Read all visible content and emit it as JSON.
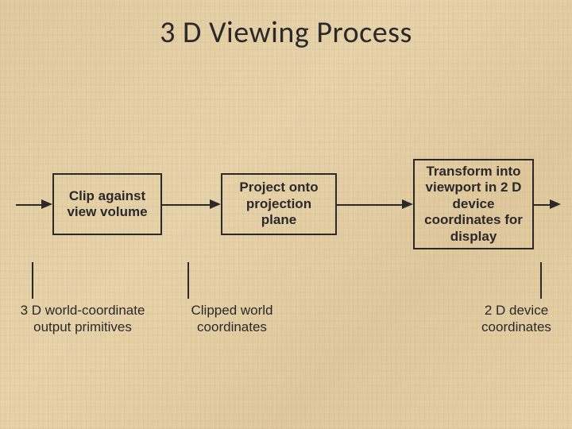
{
  "title": "3 D Viewing Process",
  "boxes": {
    "clip": "Clip against view volume",
    "project": "Project onto projection plane",
    "transform": "Transform into viewport in 2 D device coordinates for display"
  },
  "labels": {
    "world_primitives": "3 D world-coordinate output primitives",
    "clipped_world": "Clipped world coordinates",
    "device_coords": "2 D device coordinates"
  }
}
